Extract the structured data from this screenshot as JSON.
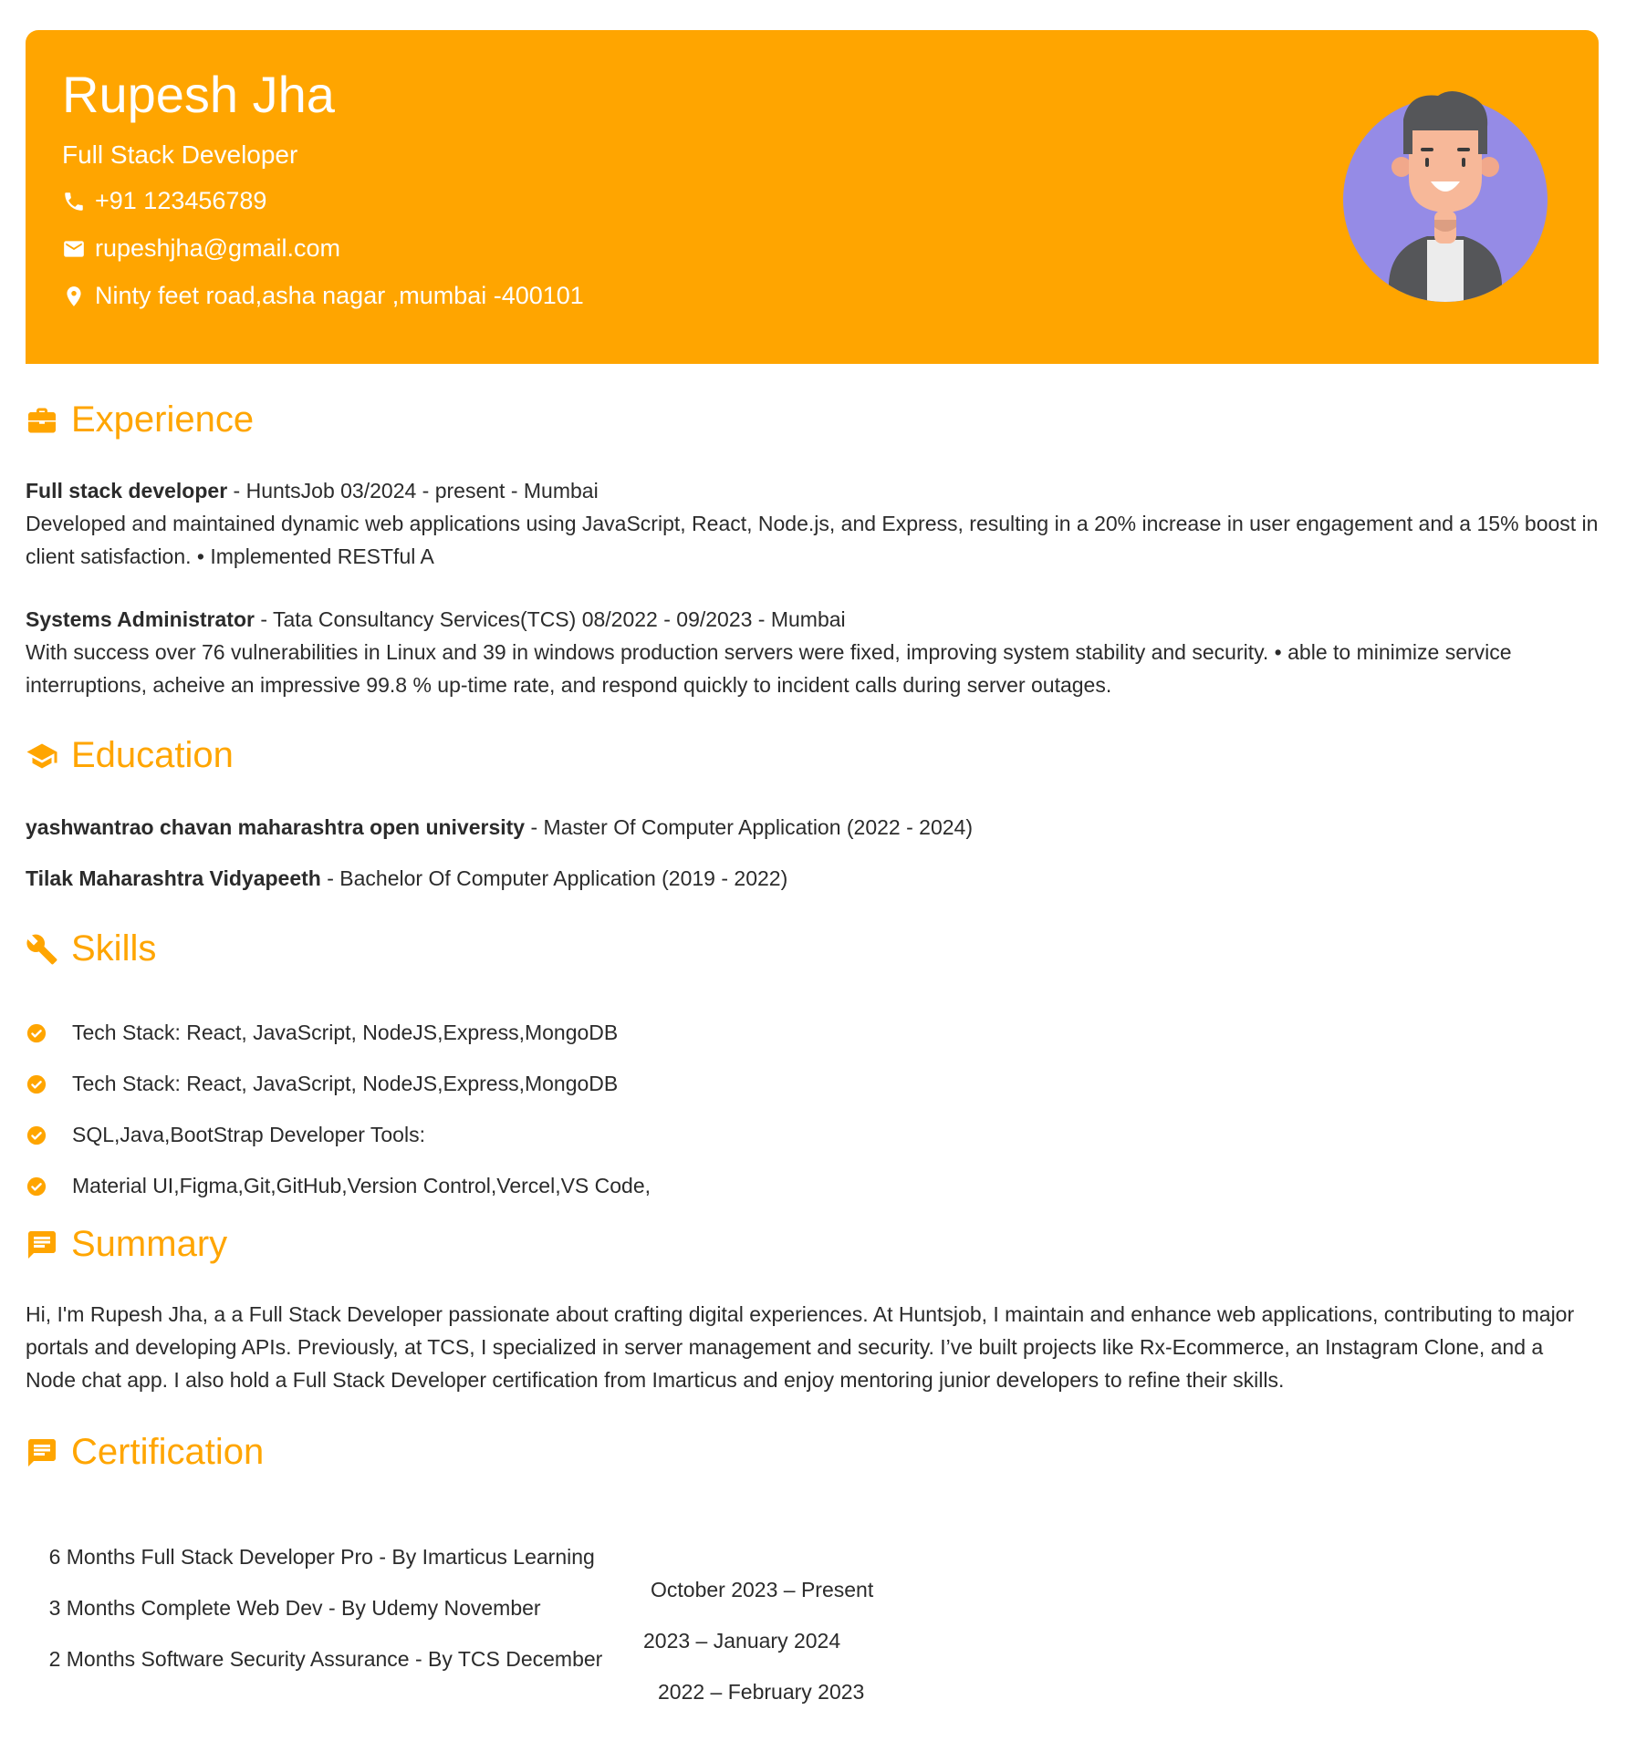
{
  "colors": {
    "accent": "#ffa500",
    "text": "#2b2b2b",
    "avatar_bg": "#958be6"
  },
  "header": {
    "name": "Rupesh Jha",
    "title": "Full Stack Developer",
    "phone": "+91 123456789",
    "email": "rupeshjha@gmail.com",
    "address": "Ninty feet road,asha nagar ,mumbai -400101"
  },
  "sections": {
    "experience": "Experience",
    "education": "Education",
    "skills": "Skills",
    "summary": "Summary",
    "certification": "Certification"
  },
  "experience": [
    {
      "role": "Full stack developer",
      "meta": " - HuntsJob 03/2024 - present - Mumbai",
      "description": "Developed and maintained dynamic web applications using JavaScript, React, Node.js, and Express, resulting in a 20% increase in user engagement and a 15% boost in client satisfaction. • Implemented RESTful A"
    },
    {
      "role": "Systems Administrator",
      "meta": " - Tata Consultancy Services(TCS) 08/2022 - 09/2023 - Mumbai",
      "description": "With success over 76 vulnerabilities in Linux and 39 in windows production servers were fixed, improving system stability and security. • able to minimize service interruptions, acheive an impressive 99.8 % up-time rate, and respond quickly to incident calls during server outages."
    }
  ],
  "education": [
    {
      "school": "yashwantrao chavan maharashtra open university",
      "detail": " - Master Of Computer Application (2022 - 2024)"
    },
    {
      "school": "Tilak Maharashtra Vidyapeeth",
      "detail": " - Bachelor Of Computer Application (2019 - 2022)"
    }
  ],
  "skills": [
    "Tech Stack: React, JavaScript, NodeJS,Express,MongoDB",
    "Tech Stack: React, JavaScript, NodeJS,Express,MongoDB",
    "SQL,Java,BootStrap Developer Tools:",
    "Material UI,Figma,Git,GitHub,Version Control,Vercel,VS Code,"
  ],
  "summary": "Hi, I'm Rupesh Jha, a a Full Stack Developer passionate about crafting digital experiences. At Huntsjob, I maintain and enhance web applications, contributing to major portals and developing APIs. Previously, at TCS, I specialized in server management and security. I’ve built projects like Rx-Ecommerce, an Instagram Clone, and a Node chat app. I also hold a Full Stack Developer certification from Imarticus and enjoy mentoring junior developers to refine their skills.",
  "certifications": [
    {
      "name": "6 Months Full Stack Developer Pro - By Imarticus Learning",
      "when": "October 2023 – Present"
    },
    {
      "name": "3 Months Complete Web Dev - By Udemy November",
      "when": "2023 – January 2024"
    },
    {
      "name": "2 Months Software Security Assurance - By TCS December",
      "when": "2022 – February 2023"
    }
  ]
}
